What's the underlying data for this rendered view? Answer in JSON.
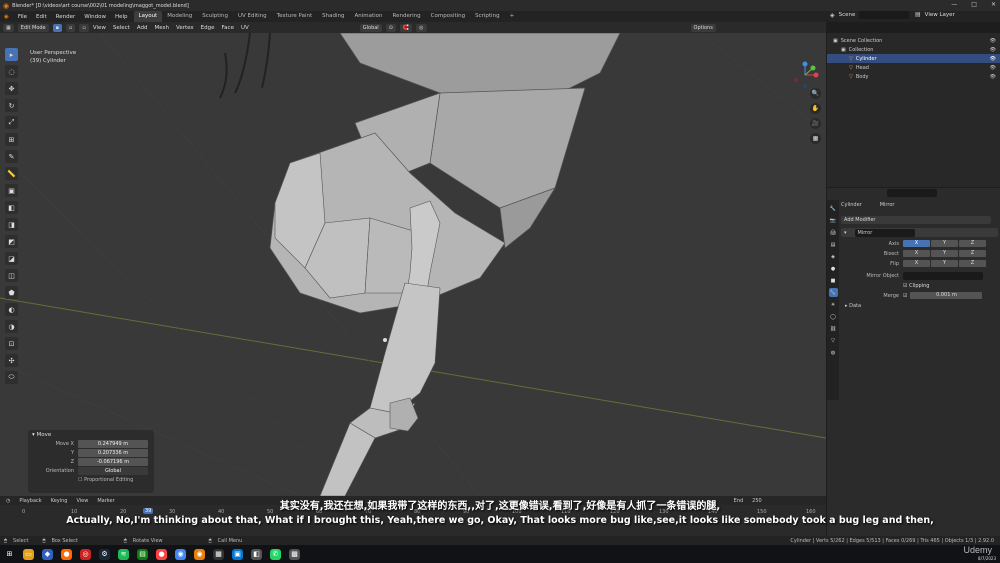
{
  "window": {
    "title": "Blender* [D:\\videos\\art course\\002\\01 modeling\\maggot_model.blend]",
    "controls": [
      "—",
      "□",
      "✕"
    ]
  },
  "menu": [
    "File",
    "Edit",
    "Render",
    "Window",
    "Help"
  ],
  "workspaces": [
    "Layout",
    "Modeling",
    "Sculpting",
    "UV Editing",
    "Texture Paint",
    "Shading",
    "Animation",
    "Rendering",
    "Compositing",
    "Scripting",
    "+"
  ],
  "active_workspace": "Layout",
  "scene": {
    "label": "Scene",
    "view_layer": "View Layer"
  },
  "header": {
    "mode": "Edit Mode",
    "menus": [
      "View",
      "Select",
      "Add",
      "Mesh",
      "Vertex",
      "Edge",
      "Face",
      "UV"
    ],
    "orientation": "Global",
    "options": "Options"
  },
  "viewport": {
    "perspective": "User Perspective",
    "object": "(39) Cylinder"
  },
  "tools": [
    "▸",
    "◌",
    "✥",
    "↻",
    "⤢",
    "⊞",
    "✎",
    "📏",
    "▣",
    "◧",
    "◨",
    "◩",
    "◪",
    "◫",
    "⬟",
    "◐",
    "◑",
    "⊡",
    "✣",
    "⬭"
  ],
  "move_panel": {
    "title": "Move",
    "rows": [
      {
        "label": "Move X",
        "value": "0.247949 m"
      },
      {
        "label": "Y",
        "value": "0.207336 m"
      },
      {
        "label": "Z",
        "value": "-0.067196 m"
      },
      {
        "label": "Orientation",
        "value": "Global"
      }
    ],
    "proportional": "Proportional Editing"
  },
  "timeline": {
    "menus": [
      "Playback",
      "Keying",
      "View",
      "Marker"
    ],
    "frame_numbers": [
      "0",
      "10",
      "20",
      "30",
      "40",
      "50",
      "60",
      "70",
      "80",
      "90",
      "100",
      "110",
      "120",
      "130",
      "140",
      "150",
      "160"
    ],
    "current_frame": "39",
    "end_label": "End",
    "end_value": "250"
  },
  "outliner": {
    "items": [
      {
        "label": "Scene Collection",
        "indent": 0
      },
      {
        "label": "Collection",
        "indent": 1
      },
      {
        "label": "Cylinder",
        "indent": 2,
        "selected": true
      },
      {
        "label": "Head",
        "indent": 2
      },
      {
        "label": "Body",
        "indent": 2
      }
    ]
  },
  "properties": {
    "object": "Cylinder",
    "modifier_name": "Mirror",
    "add_modifier": "Add Modifier",
    "modifier_field": "Mirror",
    "axis_rows": [
      {
        "label": "Axis",
        "values": [
          "X",
          "Y",
          "Z"
        ],
        "on": [
          true,
          false,
          false
        ]
      },
      {
        "label": "Bisect",
        "values": [
          "X",
          "Y",
          "Z"
        ],
        "on": [
          false,
          false,
          false
        ]
      },
      {
        "label": "Flip",
        "values": [
          "X",
          "Y",
          "Z"
        ],
        "on": [
          false,
          false,
          false
        ]
      }
    ],
    "mirror_object": "Mirror Object",
    "clipping": "Clipping",
    "merge_label": "Merge",
    "merge_value": "0.001 m",
    "data": "Data"
  },
  "statusbar": {
    "items": [
      "Select",
      "Box Select",
      "Rotate View",
      "Call Menu"
    ],
    "stats": "Cylinder | Verts 5/262 | Edges 5/513 | Faces 0/269 | Tris 465 | Objects 1/3 | 2.92.0"
  },
  "subtitles": {
    "chinese": "其实没有,我还在想,如果我带了这样的东西,,对了,这更像错误,看到了,好像是有人抓了一条错误的腿,",
    "english": "Actually, No,I'm thinking about that, What if I brought this, Yeah,there we go, Okay, That looks more bug like,see,it looks like somebody took a bug leg and then,"
  },
  "watermark": "Udemy",
  "clock": "8/7/2023",
  "colors": {
    "accent": "#4772b3",
    "selected_row": "#334d80",
    "viewport_bg": "#393939",
    "mesh": "#a9a9a9"
  }
}
